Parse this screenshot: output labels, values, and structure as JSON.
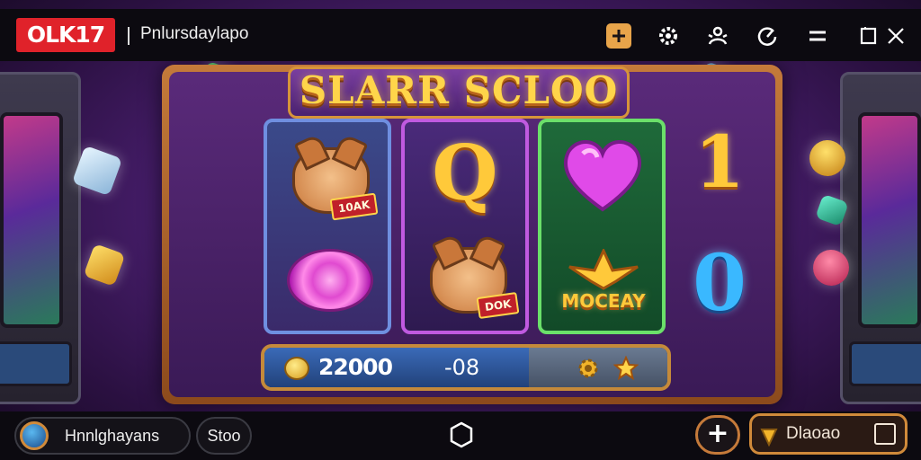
{
  "header": {
    "logo_text": "OLK17",
    "app_title": "Pnlursdaylapo",
    "icons": [
      "plus-icon",
      "gear-icon",
      "players-icon",
      "history-icon",
      "menu-icon",
      "window-icon",
      "close-icon"
    ]
  },
  "game": {
    "title": "SLARR SCLOO",
    "reels": [
      {
        "top": "dog-symbol",
        "top_tag": "10AK",
        "bottom": "candy-symbol"
      },
      {
        "top_letter": "Q",
        "bottom": "dog-symbol",
        "bottom_tag": "DOK"
      },
      {
        "top": "heart-symbol",
        "bottom_label": "MOCEAY"
      }
    ],
    "side_symbols": {
      "right_top": "1",
      "right_bottom": "0"
    }
  },
  "balance_bar": {
    "balance": "22000",
    "bet": "-08"
  },
  "footer": {
    "username": "Hnnlghayans",
    "shop_label": "Stoo",
    "wallet_label": "Dlaoao"
  },
  "colors": {
    "logo_red": "#e0222a",
    "frame_gold": "#c47a3a",
    "title_gold": "#ffd54a",
    "reel1_border": "#6f8fe0",
    "reel2_border": "#c05ae0",
    "reel3_border": "#6be06a"
  }
}
